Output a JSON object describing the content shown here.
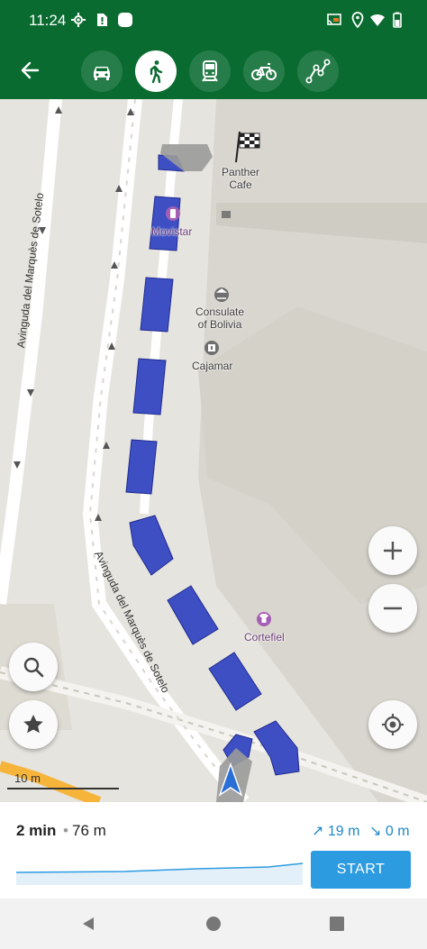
{
  "status_bar": {
    "time": "11:24",
    "left_icons": [
      "gps-icon",
      "sim-alert-icon",
      "app-icon"
    ],
    "right_icons": [
      "cast-icon",
      "location-icon",
      "wifi-icon",
      "battery-icon"
    ]
  },
  "toolbar": {
    "back_icon": "arrow-back-icon",
    "modes": [
      {
        "name": "car",
        "icon": "car-icon",
        "active": false
      },
      {
        "name": "walk",
        "icon": "walk-icon",
        "active": true
      },
      {
        "name": "transit",
        "icon": "train-icon",
        "active": false
      },
      {
        "name": "bike",
        "icon": "bike-icon",
        "active": false
      },
      {
        "name": "ruler",
        "icon": "ruler-route-icon",
        "active": false
      }
    ]
  },
  "map": {
    "pois": {
      "destination": "Panther\nCafe",
      "movistar": "Movistar",
      "consulate": "Consulate\nof Bolivia",
      "cajamar": "Cajamar",
      "cortefiel": "Cortefiel"
    },
    "streets": {
      "left": "Avinguda del Marquès de Sotelo",
      "bottom": "Avinguda del Marquès de Sotelo"
    },
    "scale": "10 m",
    "controls": [
      "zoom-in-icon",
      "zoom-out-icon",
      "my-location-icon",
      "search-icon",
      "star-icon"
    ],
    "colors": {
      "route": "#3e4fc4",
      "route_border": "#1f2b8f",
      "land": "#e6e4de",
      "building": "#d9d6cf"
    }
  },
  "route_panel": {
    "duration": "2 min",
    "separator": "•",
    "distance": "76 m",
    "ascent": "↗ 19 m",
    "descent": "↘ 0 m",
    "start_label": "START"
  },
  "nav_bar": [
    "back-nav-icon",
    "home-nav-icon",
    "recents-nav-icon"
  ]
}
